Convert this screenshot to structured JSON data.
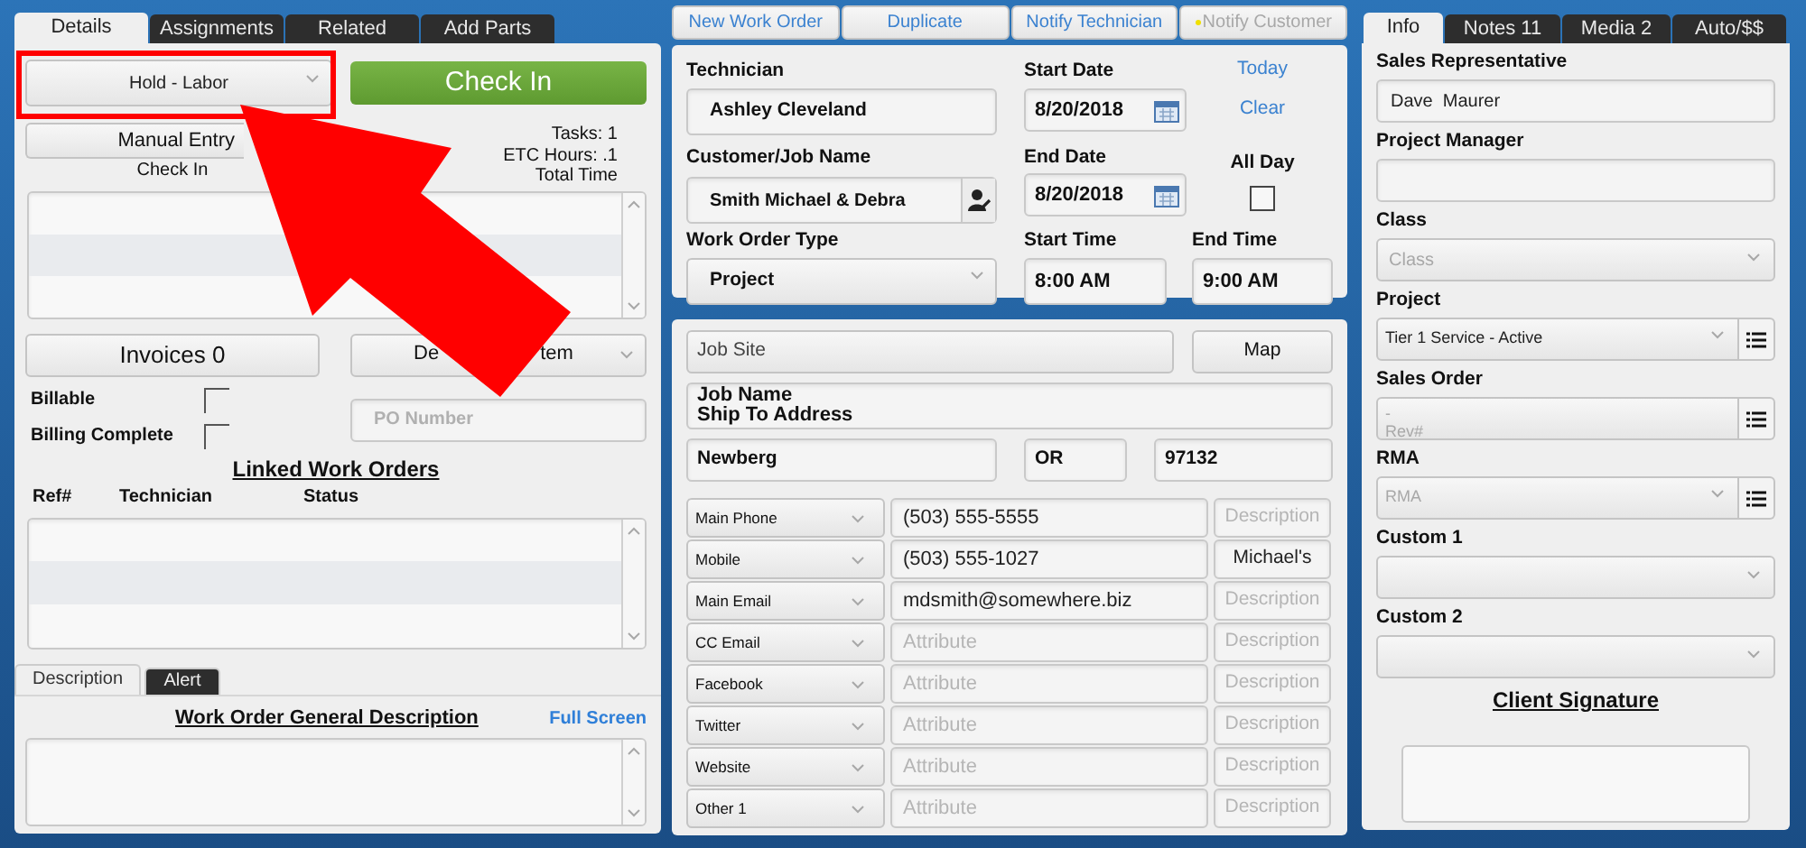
{
  "left_tabs": [
    {
      "label": "Details",
      "selected": true
    },
    {
      "label": "Assignments",
      "selected": false
    },
    {
      "label": "Related",
      "selected": false
    },
    {
      "label": "Add Parts",
      "selected": false
    }
  ],
  "status_dropdown": {
    "value": "Hold - Labor",
    "highlighted": true
  },
  "check_in_button": "Check In",
  "manual_entry_button": "Manual Entry",
  "task_info": [
    "Tasks: 1",
    "ETC Hours: .1",
    "Total Time"
  ],
  "check_in_list": {
    "title": "Check In"
  },
  "invoices_button": "Invoices 0",
  "item_dropdown": {
    "visible_text": [
      "De",
      "tem"
    ]
  },
  "checkboxes": [
    {
      "label": "Billable",
      "checked": false
    },
    {
      "label": "Billing Complete",
      "checked": false
    }
  ],
  "po_number": {
    "placeholder": "PO Number"
  },
  "linked_work_orders": {
    "title": "Linked Work Orders",
    "columns": [
      "Ref#",
      "Technician",
      "Status"
    ]
  },
  "bottom_tabs": [
    {
      "label": "Description",
      "selected": true
    },
    {
      "label": "Alert",
      "selected": false
    }
  ],
  "description": {
    "title": "Work Order General Description",
    "full_screen_link": "Full Screen"
  },
  "toolbar": [
    {
      "label": "New Work Order",
      "disabled": false,
      "flagged": false
    },
    {
      "label": "Duplicate",
      "disabled": false,
      "flagged": false
    },
    {
      "label": "Notify Technician",
      "disabled": false,
      "flagged": false
    },
    {
      "label": "Notify Customer",
      "disabled": true,
      "flagged": true
    }
  ],
  "schedule": {
    "technician": {
      "label": "Technician",
      "value": "Ashley Cleveland"
    },
    "start_date": {
      "label": "Start Date",
      "value": "8/20/2018"
    },
    "today_link": "Today",
    "clear_link": "Clear",
    "customer": {
      "label": "Customer/Job Name",
      "value": "Smith Michael & Debra"
    },
    "end_date": {
      "label": "End Date",
      "value": "8/20/2018"
    },
    "all_day": {
      "label": "All Day",
      "checked": false
    },
    "work_order_type": {
      "label": "Work Order Type",
      "value": "Project"
    },
    "start_time": {
      "label": "Start Time",
      "value": "8:00 AM"
    },
    "end_time": {
      "label": "End Time",
      "value": "9:00 AM"
    }
  },
  "job_site": {
    "placeholder": "Job Site",
    "map_button": "Map",
    "address": [
      "Job Name",
      "Ship To Address"
    ],
    "city": "Newberg",
    "state": "OR",
    "zip": "97132"
  },
  "contacts": [
    {
      "type": "Main Phone",
      "value": "(503) 555-5555",
      "description_placeholder": "Description"
    },
    {
      "type": "Mobile",
      "value": "(503) 555-1027",
      "description": "Michael's"
    },
    {
      "type": "Main Email",
      "value": "mdsmith@somewhere.biz",
      "description_placeholder": "Description"
    },
    {
      "type": "CC Email",
      "placeholder": "Attribute",
      "description_placeholder": "Description"
    },
    {
      "type": "Facebook",
      "placeholder": "Attribute",
      "description_placeholder": "Description"
    },
    {
      "type": "Twitter",
      "placeholder": "Attribute",
      "description_placeholder": "Description"
    },
    {
      "type": "Website",
      "placeholder": "Attribute",
      "description_placeholder": "Description"
    },
    {
      "type": "Other 1",
      "placeholder": "Attribute",
      "description_placeholder": "Description"
    }
  ],
  "right_tabs": [
    {
      "label": "Info",
      "selected": true
    },
    {
      "label": "Notes 11",
      "selected": false
    },
    {
      "label": "Media 2",
      "selected": false
    },
    {
      "label": "Auto/$$",
      "selected": false
    }
  ],
  "info_fields": [
    {
      "label": "Sales Representative",
      "kind": "text",
      "value": "Dave  Maurer"
    },
    {
      "label": "Project Manager",
      "kind": "text"
    },
    {
      "label": "Class",
      "kind": "dropdown",
      "placeholder": "Class"
    },
    {
      "label": "Project",
      "kind": "list",
      "value": "Tier 1 Service - Active"
    },
    {
      "label": "Sales Order",
      "kind": "list",
      "lines": [
        "-",
        "Rev#"
      ]
    },
    {
      "label": "RMA",
      "kind": "list",
      "placeholder": "RMA"
    },
    {
      "label": "Custom 1",
      "kind": "dropdown"
    },
    {
      "label": "Custom 2",
      "kind": "dropdown"
    }
  ],
  "signature": {
    "title": "Client Signature"
  }
}
